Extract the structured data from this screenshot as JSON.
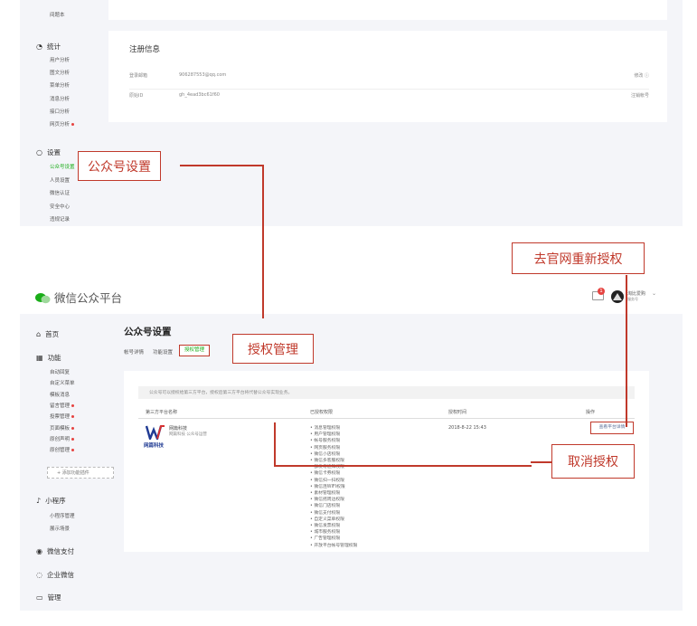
{
  "top_sidebar": {
    "prev_item": "间题本",
    "stats": {
      "label": "统计",
      "icon": "chart-icon",
      "items": [
        "用户分析",
        "图文分析",
        "菜单分析",
        "消息分析",
        "接口分析",
        "网页分析"
      ],
      "dot_index": 5
    },
    "settings": {
      "label": "设置",
      "icon": "circle-icon",
      "items": [
        "公众号设置",
        "人员设置",
        "微信认证",
        "安全中心",
        "违规记录"
      ],
      "active_index": 0
    }
  },
  "top_main": {
    "section_title": "注册信息",
    "rows": [
      {
        "label": "登录邮箱",
        "value": "906287553@qq.com",
        "action": "修改 ⓘ"
      },
      {
        "label": "原始ID",
        "value": "gh_4ead3bc61f60",
        "action": "注销帐号"
      }
    ]
  },
  "bottom_header": {
    "logo_text": "微信公众平台",
    "notif_count": "1",
    "user_name": "淘比爱购",
    "user_sub": "服务号",
    "dropdown": "⌄"
  },
  "bottom_sidebar": {
    "home": "首页",
    "function": {
      "label": "功能",
      "items": [
        {
          "label": "自动回复",
          "dot": false
        },
        {
          "label": "自定义菜单",
          "dot": false
        },
        {
          "label": "模板消息",
          "dot": false
        },
        {
          "label": "留言管理",
          "dot": true
        },
        {
          "label": "投票管理",
          "dot": true
        },
        {
          "label": "页面模板",
          "dot": true
        },
        {
          "label": "原创声明",
          "dot": true
        },
        {
          "label": "原创管理",
          "dot": true
        }
      ],
      "add_plugin": "+ 添加功能插件"
    },
    "mini": {
      "label": "小程序",
      "items": [
        "小程序管理",
        "展示场景"
      ]
    },
    "pay": "微信支付",
    "work": "企业微信",
    "manage": "管理"
  },
  "bottom_main": {
    "page_title": "公众号设置",
    "tabs": [
      "帐号详情",
      "功能设置",
      "授权管理"
    ],
    "active_tab": 2,
    "notice": "公众号可以授权给第三方平台，授权后第三方平台将代替公众号实现业务。",
    "table": {
      "headers": [
        "第三方平台名称",
        "已授权权限",
        "授权时间",
        "操作"
      ],
      "row": {
        "name": "网篇科技",
        "desc": "网篇科技 公众号运营",
        "logo_text": "网篇科技",
        "permissions": [
          "消息管理权限",
          "用户管理权限",
          "帐号服务权限",
          "网页服务权限",
          "微信小店权限",
          "微信多客服权限",
          "群发与通知权限",
          "微信卡券权限",
          "微信扫一扫权限",
          "微信连WIFI权限",
          "素材管理权限",
          "微信摇周边权限",
          "微信门店权限",
          "微信支付权限",
          "自定义菜单权限",
          "微信发票权限",
          "城市服务权限",
          "广告管理权限",
          "开放平台帐号管理权限"
        ],
        "time": "2018-8-22 15:43",
        "action": "查看平台详情"
      }
    }
  },
  "callouts": {
    "gzh_settings": "公众号设置",
    "auth_mgmt": "授权管理",
    "reauth": "去官网重新授权",
    "cancel_auth": "取消授权"
  },
  "colors": {
    "accent": "#c0392b",
    "wechat_green": "#1aad19",
    "panel_bg": "#f4f5f9"
  }
}
